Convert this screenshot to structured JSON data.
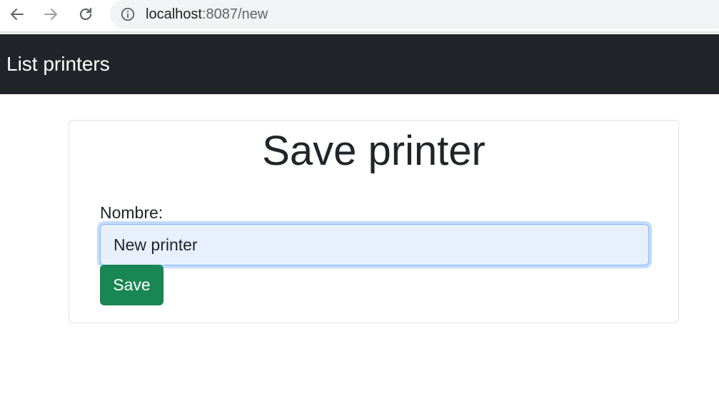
{
  "browser": {
    "url_host": "localhost",
    "url_rest": ":8087/new",
    "icons": {
      "back": "back-arrow-icon",
      "forward": "forward-arrow-icon",
      "reload": "reload-icon",
      "info": "info-icon"
    }
  },
  "navbar": {
    "brand_label": "List printers",
    "background": "#212529"
  },
  "form": {
    "title": "Save printer",
    "name_label": "Nombre:",
    "name_value": "New printer",
    "save_label": "Save",
    "save_color": "#198754"
  }
}
